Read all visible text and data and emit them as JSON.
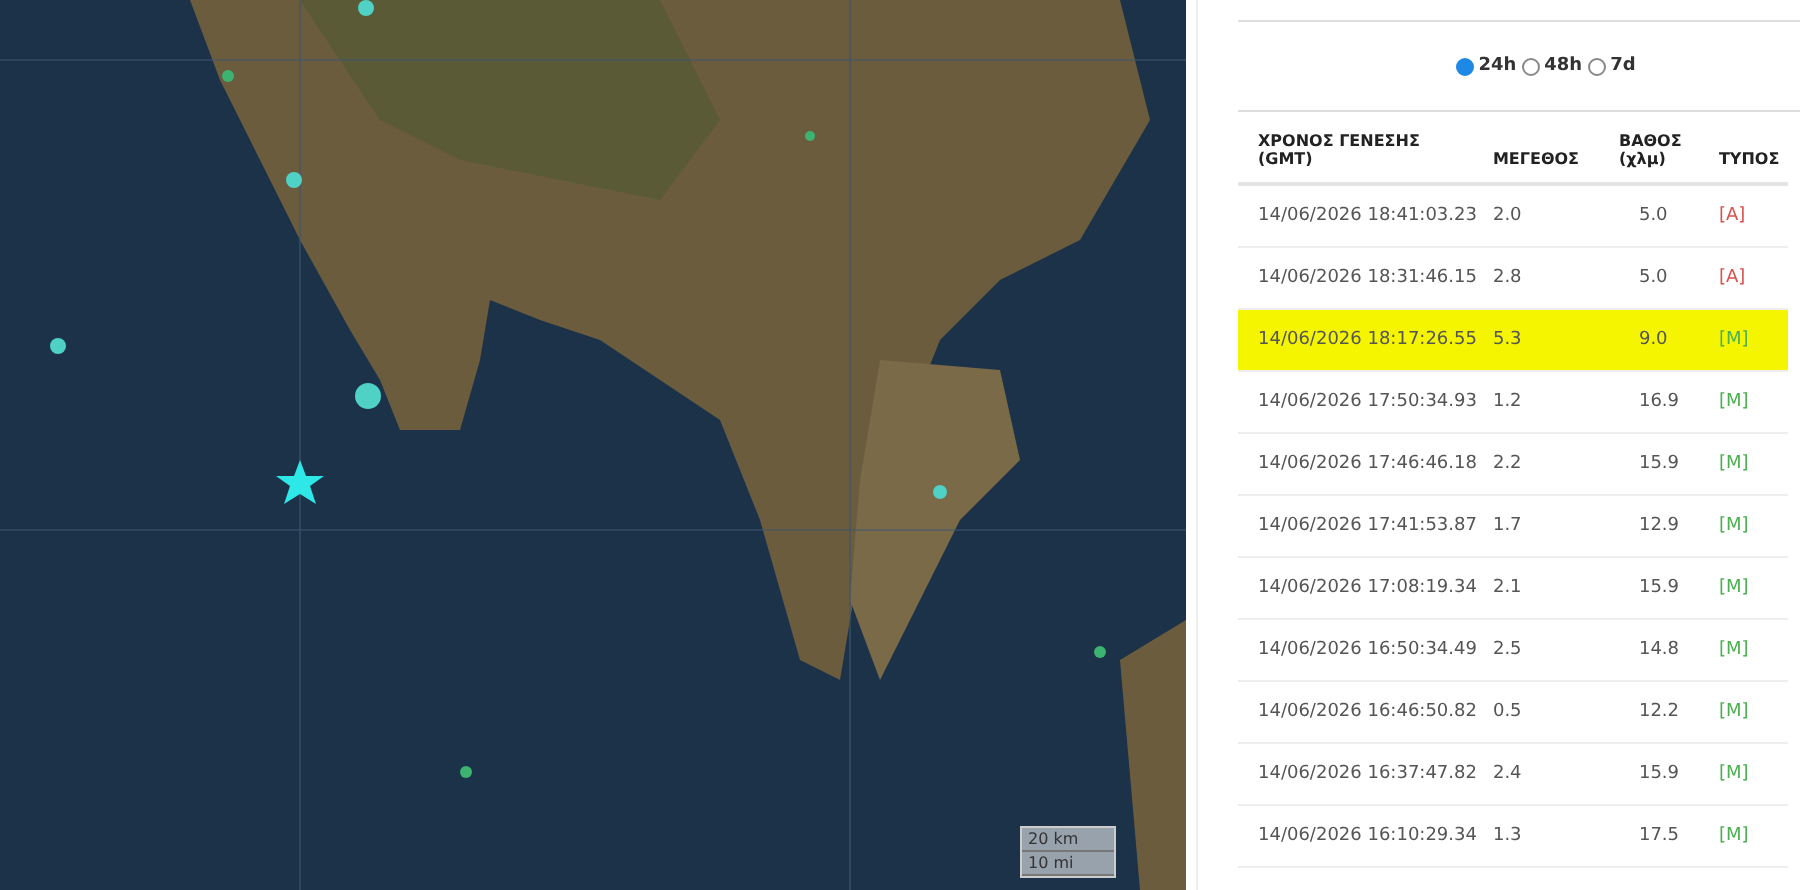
{
  "map": {
    "scale": [
      "20 km",
      "10 mi"
    ]
  },
  "period": [
    {
      "label": "24h",
      "selected": true
    },
    {
      "label": "48h",
      "selected": false
    },
    {
      "label": "7d",
      "selected": false
    }
  ],
  "table": {
    "columns": [
      "ΧΡΟΝΟΣ ΓΕΝΕΣΗΣ (GMT)",
      "ΜΕΓΕΘΟΣ",
      "ΒΑΘΟΣ (χλμ)",
      "ΤΥΠΟΣ"
    ],
    "rows": [
      {
        "time": "14/06/2026 18:41:03.23",
        "magnitude": "2.0",
        "depth": "5.0",
        "type": "[A]",
        "color": "#d9534f",
        "selected": false
      },
      {
        "time": "14/06/2026 18:31:46.15",
        "magnitude": "2.8",
        "depth": "5.0",
        "type": "[A]",
        "color": "#d9534f",
        "selected": false
      },
      {
        "time": "14/06/2026 18:17:26.55",
        "magnitude": "5.3",
        "depth": "9.0",
        "type": "[M]",
        "color": "#4caf50",
        "selected": true
      },
      {
        "time": "14/06/2026 17:50:34.93",
        "magnitude": "1.2",
        "depth": "16.9",
        "type": "[M]",
        "color": "#4caf50",
        "selected": false
      },
      {
        "time": "14/06/2026 17:46:46.18",
        "magnitude": "2.2",
        "depth": "15.9",
        "type": "[M]",
        "color": "#4caf50",
        "selected": false
      },
      {
        "time": "14/06/2026 17:41:53.87",
        "magnitude": "1.7",
        "depth": "12.9",
        "type": "[M]",
        "color": "#4caf50",
        "selected": false
      },
      {
        "time": "14/06/2026 17:08:19.34",
        "magnitude": "2.1",
        "depth": "15.9",
        "type": "[M]",
        "color": "#4caf50",
        "selected": false
      },
      {
        "time": "14/06/2026 16:50:34.49",
        "magnitude": "2.5",
        "depth": "14.8",
        "type": "[M]",
        "color": "#4caf50",
        "selected": false
      },
      {
        "time": "14/06/2026 16:46:50.82",
        "magnitude": "0.5",
        "depth": "12.2",
        "type": "[M]",
        "color": "#4caf50",
        "selected": false
      },
      {
        "time": "14/06/2026 16:37:47.82",
        "magnitude": "2.4",
        "depth": "15.9",
        "type": "[M]",
        "color": "#4caf50",
        "selected": false
      },
      {
        "time": "14/06/2026 16:10:29.34",
        "magnitude": "1.3",
        "depth": "17.5",
        "type": "[M]",
        "color": "#4caf50",
        "selected": false
      }
    ]
  }
}
